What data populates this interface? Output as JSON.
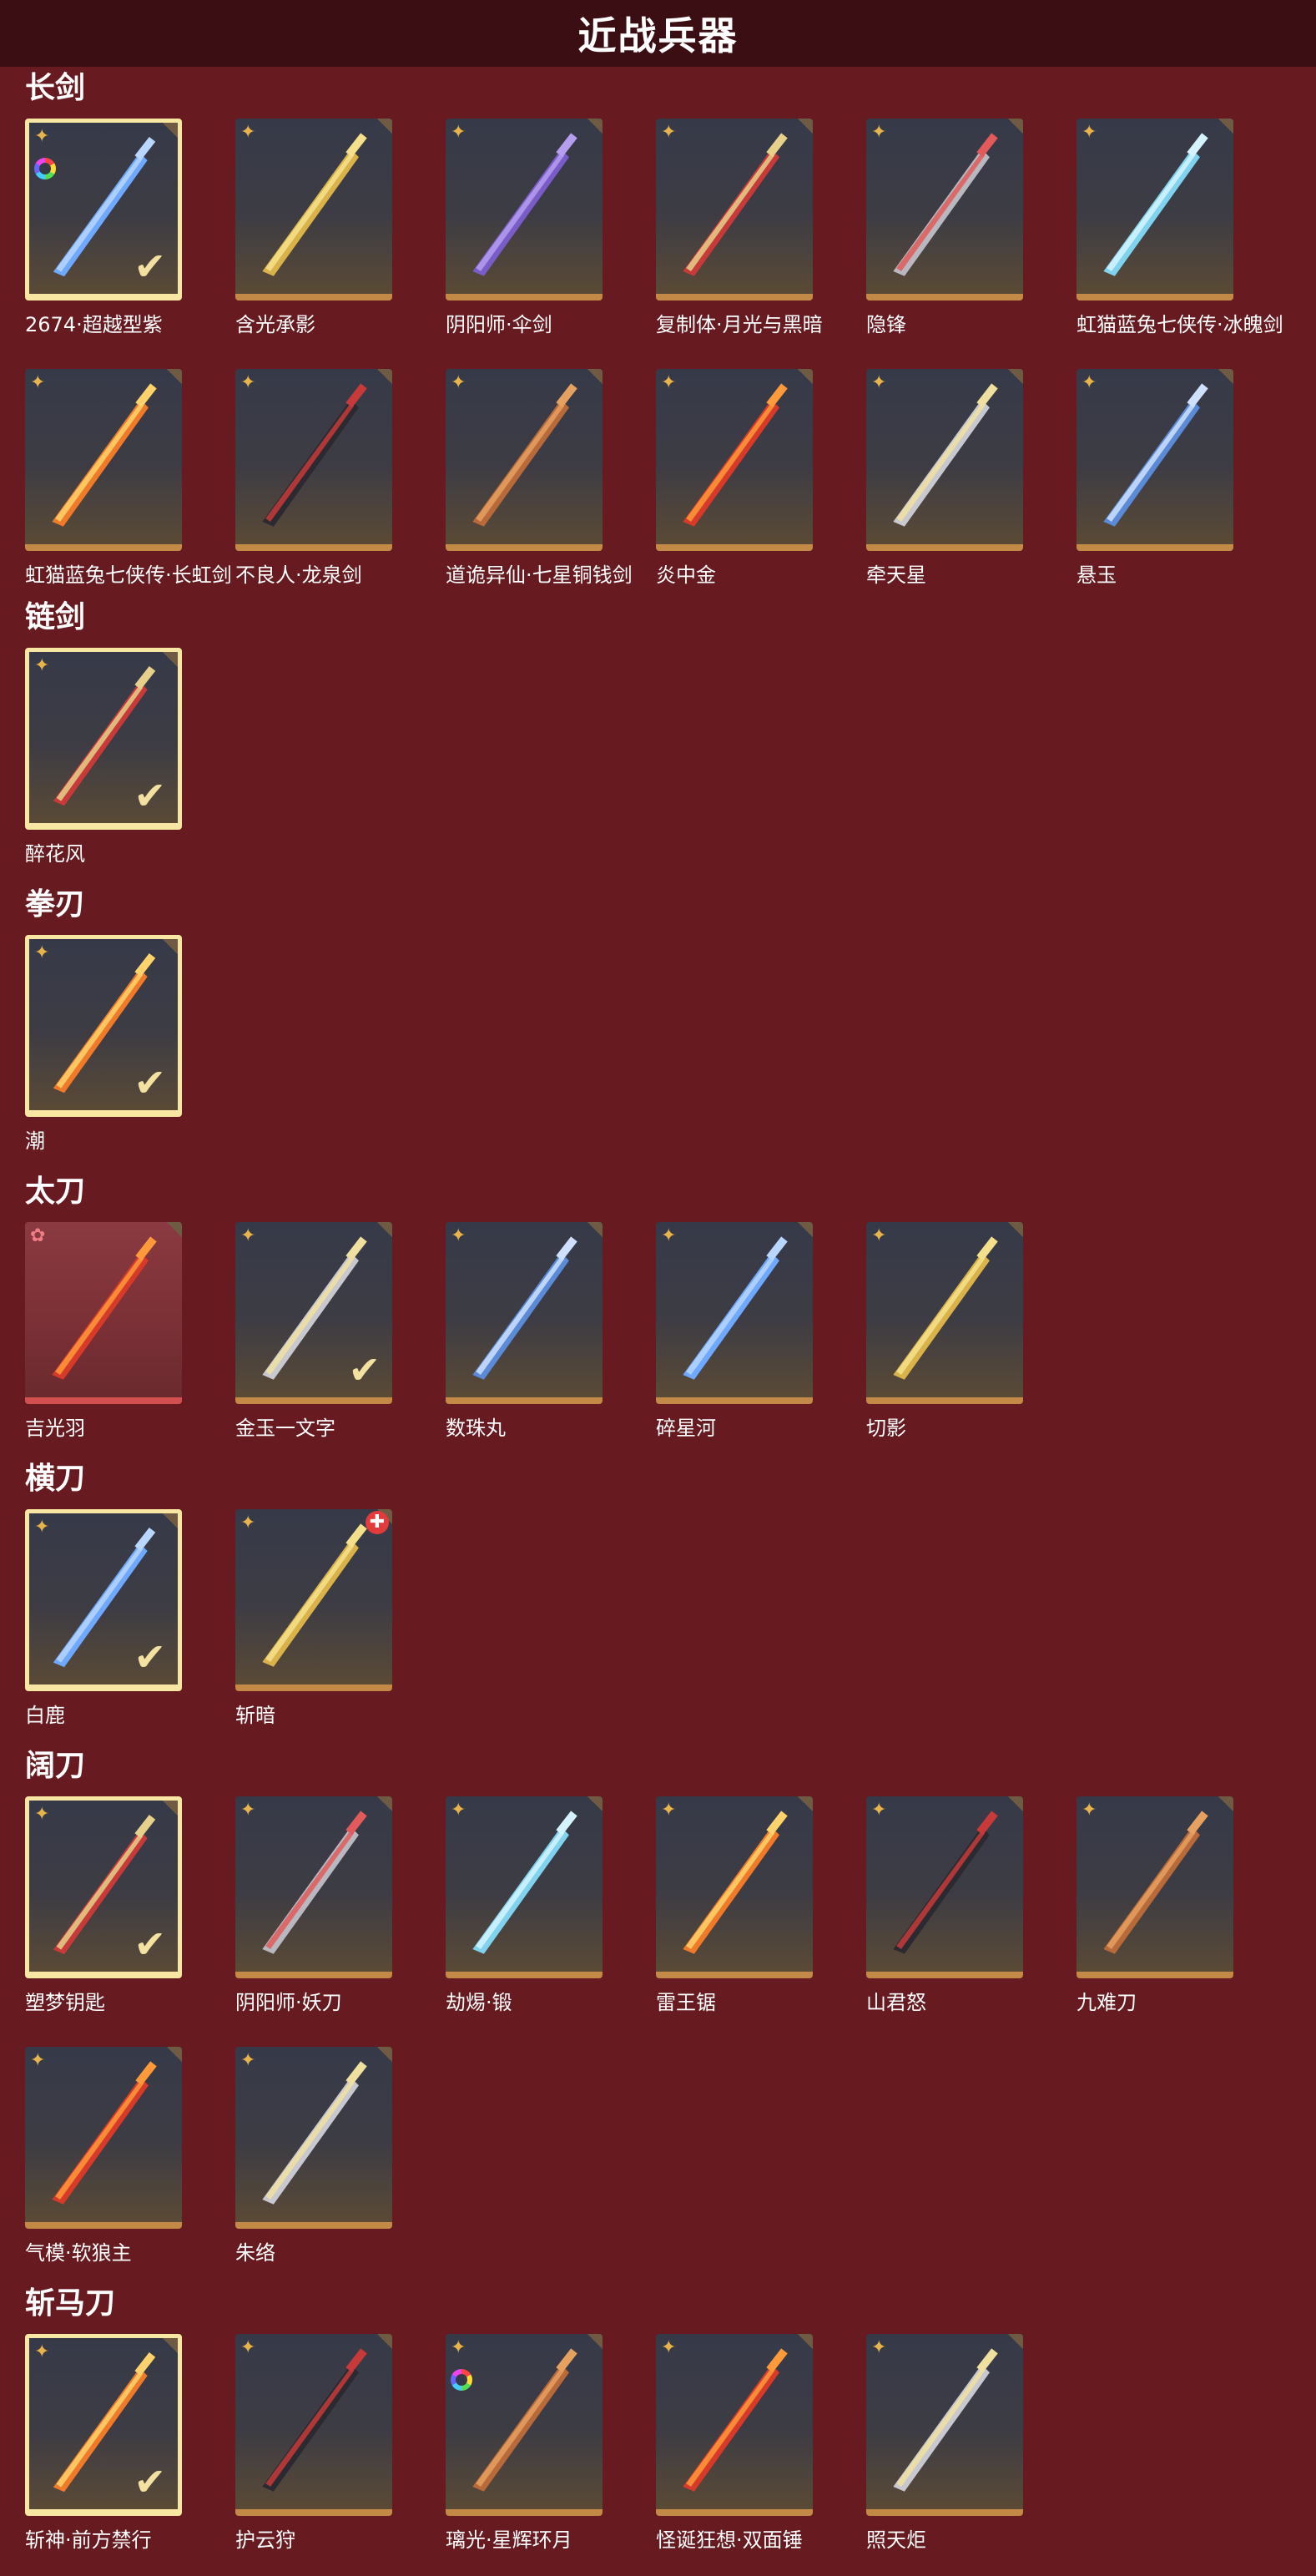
{
  "header": {
    "title": "近战兵器"
  },
  "colors": {
    "background": "#671a1f",
    "topbar": "#3a0e12",
    "card_border": "#c28a46",
    "selected_border": "#f8e7a2",
    "star": "#e8b34a"
  },
  "sections": [
    {
      "title": "长剑",
      "items": [
        {
          "name": "2674·超越型紫",
          "icon": "glowing-blue-sword-icon",
          "selected": true,
          "badge": "rainbow-ring"
        },
        {
          "name": "含光承影",
          "icon": "golden-sword-icon"
        },
        {
          "name": "阴阳师·伞剑",
          "icon": "purple-umbrella-sword-icon"
        },
        {
          "name": "复制体·月光与黑暗",
          "icon": "red-curved-sword-icon"
        },
        {
          "name": "隐锋",
          "icon": "slim-sword-icon"
        },
        {
          "name": "虹猫蓝兔七侠传·冰魄剑",
          "icon": "ice-sword-icon"
        },
        {
          "name": "虹猫蓝兔七侠传·长虹剑",
          "icon": "orange-fire-sword-icon"
        },
        {
          "name": "不良人·龙泉剑",
          "icon": "dark-red-sword-icon"
        },
        {
          "name": "道诡异仙·七星铜钱剑",
          "icon": "coin-sword-icon"
        },
        {
          "name": "炎中金",
          "icon": "flame-sword-icon"
        },
        {
          "name": "牵天星",
          "icon": "silver-sword-icon"
        },
        {
          "name": "悬玉",
          "icon": "jade-sword-icon"
        }
      ]
    },
    {
      "title": "链剑",
      "items": [
        {
          "name": "醉花风",
          "icon": "purple-chain-sword-icon",
          "selected": true
        }
      ]
    },
    {
      "title": "拳刃",
      "items": [
        {
          "name": "潮",
          "icon": "claw-blade-icon",
          "selected": true
        }
      ]
    },
    {
      "title": "太刀",
      "items": [
        {
          "name": "吉光羽",
          "icon": "flame-katana-icon",
          "rarity": "red"
        },
        {
          "name": "金玉一文字",
          "icon": "gold-katana-icon",
          "selected_check": true
        },
        {
          "name": "数珠丸",
          "icon": "purple-katana-icon"
        },
        {
          "name": "碎星河",
          "icon": "blue-katana-icon"
        },
        {
          "name": "切影",
          "icon": "green-katana-icon"
        }
      ]
    },
    {
      "title": "横刀",
      "items": [
        {
          "name": "白鹿",
          "icon": "white-deer-blade-icon",
          "selected": true
        },
        {
          "name": "斩暗",
          "icon": "bronze-blade-icon",
          "badge": "red-flag"
        }
      ]
    },
    {
      "title": "阔刀",
      "items": [
        {
          "name": "塑梦钥匙",
          "icon": "key-broadsword-icon",
          "selected": true
        },
        {
          "name": "阴阳师·妖刀",
          "icon": "demon-blade-icon"
        },
        {
          "name": "劫焬·锻",
          "icon": "black-red-broadsword-icon"
        },
        {
          "name": "雷王锯",
          "icon": "thunder-saw-icon"
        },
        {
          "name": "山君怒",
          "icon": "tiger-broadsword-icon"
        },
        {
          "name": "九难刀",
          "icon": "teal-broadsword-icon"
        },
        {
          "name": "气模·软狼主",
          "icon": "inflatable-blade-icon"
        },
        {
          "name": "朱络",
          "icon": "red-ribbon-blade-icon"
        }
      ]
    },
    {
      "title": "斩马刀",
      "items": [
        {
          "name": "斩神·前方禁行",
          "icon": "traffic-sign-blade-icon",
          "selected": true
        },
        {
          "name": "护云狩",
          "icon": "hook-blade-icon"
        },
        {
          "name": "璃光·星辉环月",
          "icon": "moon-ring-staff-icon",
          "badge": "rainbow-ring"
        },
        {
          "name": "怪诞狂想·双面锤",
          "icon": "clown-hammer-icon"
        },
        {
          "name": "照天炬",
          "icon": "torch-blade-icon"
        }
      ]
    }
  ]
}
